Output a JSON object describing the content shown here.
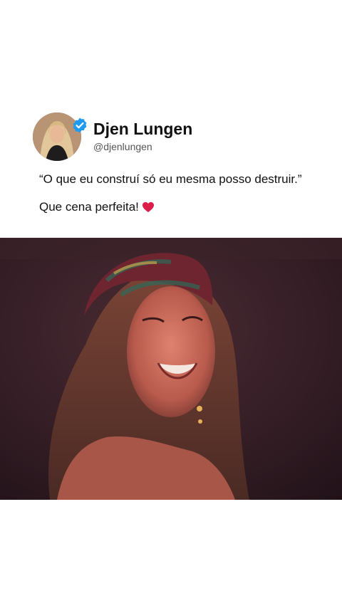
{
  "post": {
    "display_name": "Djen Lungen",
    "handle": "@djenlungen",
    "verified_icon": "verified-badge-icon",
    "line1": "“O que eu construí só eu mesma posso destruir.”",
    "line2": "Que cena perfeita!",
    "emoji_icon": "red-heart-icon"
  },
  "colors": {
    "verified_blue": "#1d9bf0",
    "heart_red": "#d91f4a",
    "background": "#ffffff"
  }
}
